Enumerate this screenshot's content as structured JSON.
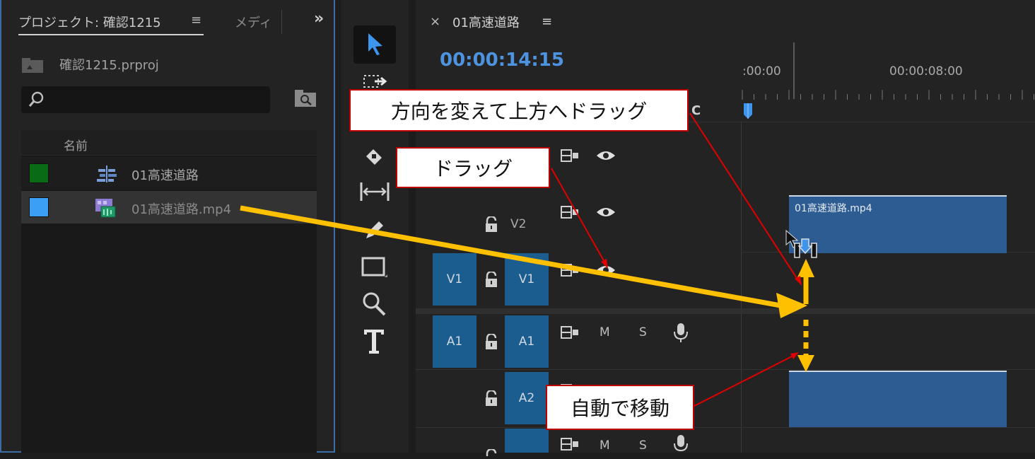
{
  "project_panel": {
    "tab_project": "プロジェクト: 確認1215",
    "tab_media": "メディ",
    "file_name": "確認1215.prproj",
    "search_placeholder": "",
    "column_name": "名前",
    "items": [
      {
        "name": "01高速道路",
        "color": "#0a6b16",
        "type": "sequence"
      },
      {
        "name": "01高速道路.mp4",
        "color": "#3ba0f5",
        "type": "video"
      }
    ],
    "menu_glyph": "≡",
    "more_glyph": "»"
  },
  "timeline": {
    "tab_close": "×",
    "tab_title": "01高速道路",
    "menu_glyph": "≡",
    "timecode": "00:00:14:15",
    "ruler_start": ":00:00",
    "ruler_mid": "00:00:08:00",
    "tracks": {
      "v2": "V2",
      "v1_src": "V1",
      "v1": "V1",
      "a1_src": "A1",
      "a1": "A1",
      "a2": "A2"
    },
    "m": "M",
    "s": "S",
    "clip_v2_label": "01高速道路.mp4"
  },
  "callouts": {
    "rotate_drag": "方向を変えて上方へドラッグ",
    "drag": "ドラッグ",
    "auto_move": "自動で移動"
  },
  "colors": {
    "accent": "#4d93e0",
    "track_blue": "#1b5d8f",
    "clip_blue": "#2d5c92",
    "arrow": "#ffc000",
    "callout_border": "#c00000"
  }
}
